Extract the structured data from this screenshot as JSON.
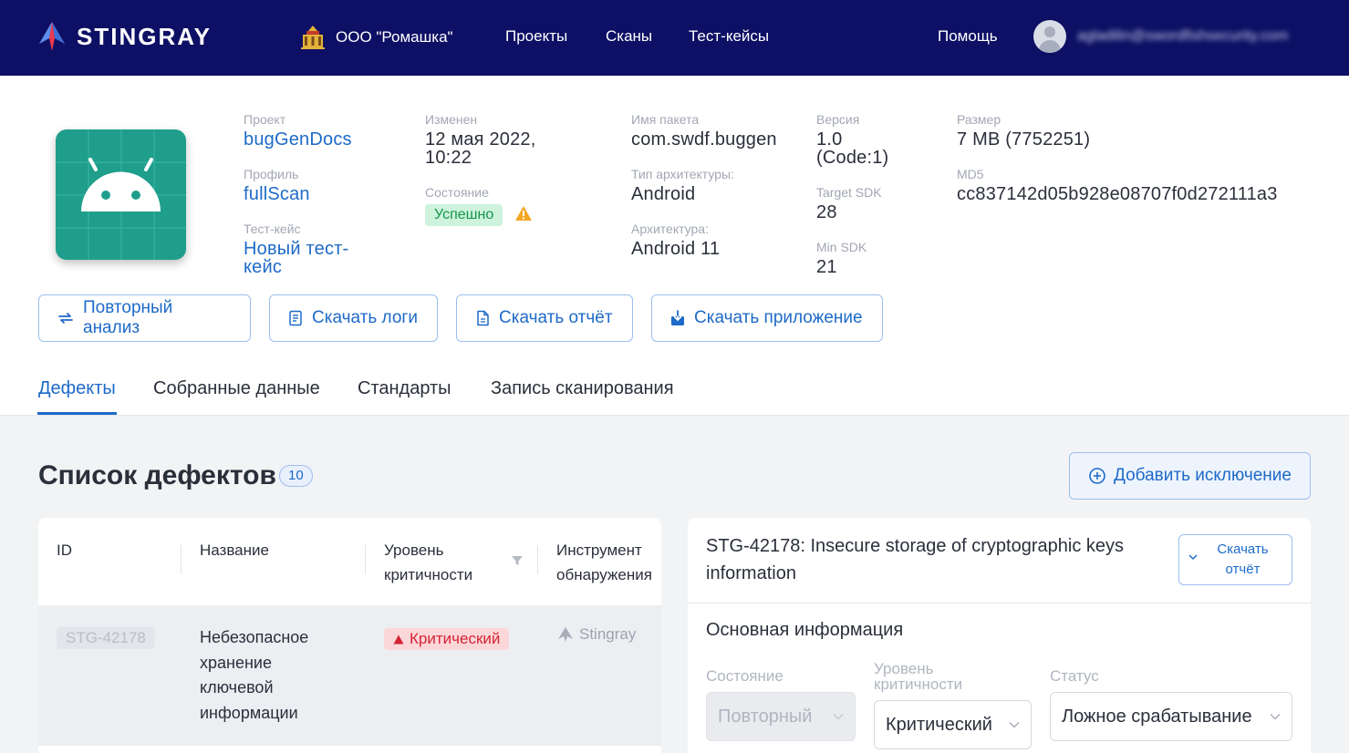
{
  "header": {
    "brand": "STINGRAY",
    "org": "ООО \"Ромашка\"",
    "nav": [
      "Проекты",
      "Сканы",
      "Тест-кейсы"
    ],
    "help": "Помощь",
    "email": "agladilin@swordfishsecurity.com",
    "colors": {
      "bg": "#0d1064"
    }
  },
  "info": {
    "project_label": "Проект",
    "project": "bugGenDocs",
    "profile_label": "Профиль",
    "profile": "fullScan",
    "testcase_label": "Тест-кейс",
    "testcase_line1": "Новый тест-",
    "testcase_line2": "кейс",
    "changed_label": "Изменен",
    "changed_line1": "12 мая 2022,",
    "changed_line2": "10:22",
    "state_label": "Состояние",
    "state": "Успешно",
    "package_label": "Имя пакета",
    "package": "com.swdf.buggen",
    "arch_type_label": "Тип архитектуры:",
    "arch_type": "Android",
    "arch_label": "Архитектура:",
    "arch": "Android 11",
    "version_label": "Версия",
    "version_line1": "1.0",
    "version_line2": "(Code:1)",
    "target_sdk_label": "Target SDK",
    "target_sdk": "28",
    "min_sdk_label": "Min SDK",
    "min_sdk": "21",
    "size_label": "Размер",
    "size": "7 MB (7752251)",
    "md5_label": "MD5",
    "md5": "cc837142d05b928e08707f0d272111a3"
  },
  "actions": {
    "reanalyze": "Повторный анализ",
    "logs": "Скачать логи",
    "report": "Скачать отчёт",
    "app": "Скачать приложение"
  },
  "tabs": [
    "Дефекты",
    "Собранные данные",
    "Стандарты",
    "Запись сканирования"
  ],
  "defects": {
    "title": "Список дефектов",
    "count": "10",
    "add_exception": "Добавить исключение",
    "columns": {
      "id": "ID",
      "name": "Название",
      "severity_line1": "Уровень",
      "severity_line2": "критичности",
      "tool_line1": "Инструмент",
      "tool_line2": "обнаружения"
    },
    "rows": [
      {
        "id": "STG-42178",
        "name_lines": [
          "Небезопасное",
          "хранение",
          "ключевой",
          "информации"
        ],
        "severity": "Критический",
        "tool": "Stingray"
      }
    ]
  },
  "detail": {
    "title_line1": "STG-42178: Insecure storage of cryptographic keys",
    "title_line2": "information",
    "download_line1": "Скачать",
    "download_line2": "отчёт",
    "section": "Основная информация",
    "state_label": "Состояние",
    "state_value": "Повторный",
    "severity_label_line1": "Уровень",
    "severity_label_line2": "критичности",
    "severity_value": "Критический",
    "status_label": "Статус",
    "status_value": "Ложное срабатывание"
  }
}
